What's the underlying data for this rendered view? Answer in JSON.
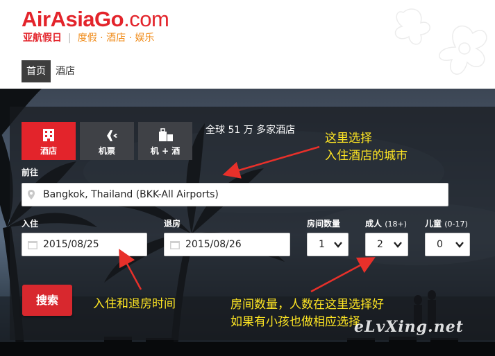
{
  "header": {
    "logo_main_bold1": "AirAsia",
    "logo_main_bold2": "Go",
    "logo_main_thin": ".com",
    "logo_brand_cn": "亚航假日",
    "logo_separator": "|",
    "logo_tagline": "度假 · 酒店 · 娱乐"
  },
  "nav": {
    "items": [
      {
        "label": "首页",
        "active": true
      },
      {
        "label": "酒店",
        "active": false
      }
    ]
  },
  "tabs": [
    {
      "label": "酒店",
      "icon": "hotel-icon",
      "active": true
    },
    {
      "label": "机票",
      "icon": "plane-icon",
      "active": false
    },
    {
      "label": "机 + 酒",
      "icon": "plane-hotel-icon",
      "active": false
    }
  ],
  "tab_description": "全球 51 万 多家酒店",
  "form": {
    "destination_label": "前往",
    "destination_value": "Bangkok, Thailand (BKK-All Airports)",
    "checkin_label": "入住",
    "checkin_value": "2015/08/25",
    "checkout_label": "退房",
    "checkout_value": "2015/08/26",
    "rooms_label": "房间数量",
    "rooms_value": "1",
    "adults_label": "成人",
    "adults_note": "(18+)",
    "adults_value": "2",
    "children_label": "儿童",
    "children_note": "(0-17)",
    "children_value": "0",
    "search_label": "搜索"
  },
  "annotations": {
    "city_line1": "这里选择",
    "city_line2": "入住酒店的城市",
    "dates": "入住和退房时间",
    "guests_line1": "房间数量，人数在这里选择好",
    "guests_line2": "如果有小孩也做相应选择"
  },
  "watermark": "eLvXing.net",
  "colors": {
    "brand_red": "#e3242b",
    "tagline_orange": "#f08c1b",
    "annotation_yellow": "#ffe623",
    "arrow_red": "#e8302a"
  }
}
